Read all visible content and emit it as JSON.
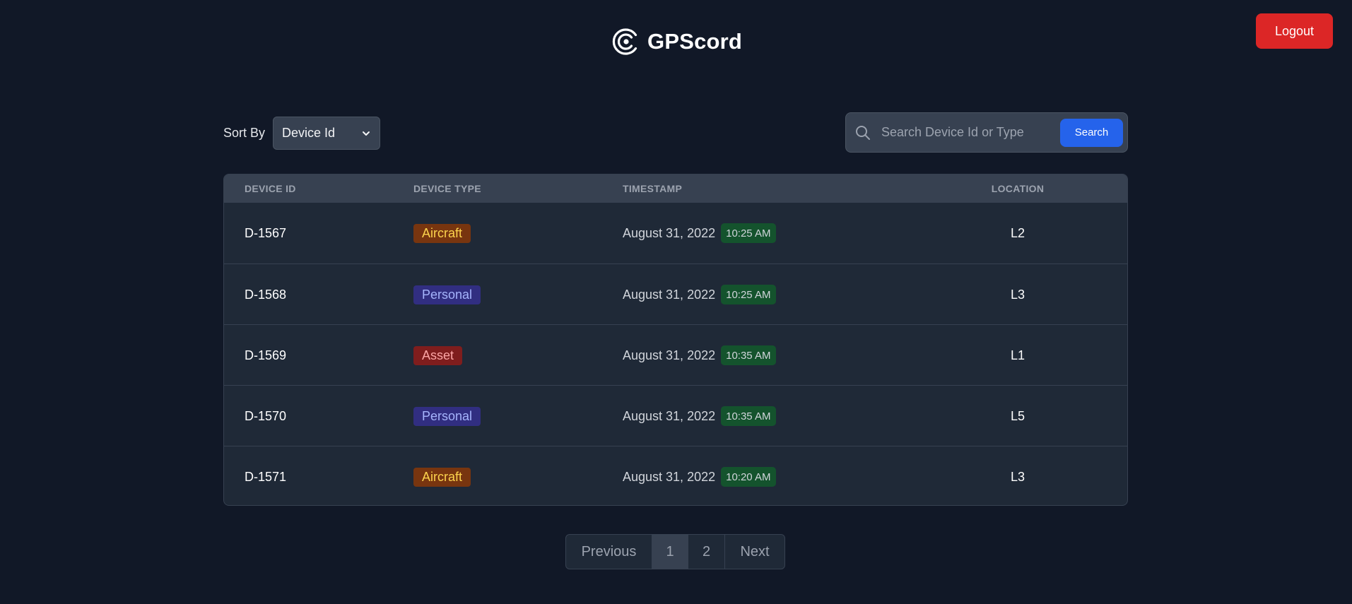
{
  "header": {
    "app_name": "GPScord",
    "logout_label": "Logout"
  },
  "controls": {
    "sort_label": "Sort By",
    "sort_selected": "Device Id",
    "search_placeholder": "Search Device Id or Type",
    "search_button": "Search"
  },
  "table": {
    "columns": [
      "DEVICE ID",
      "DEVICE TYPE",
      "TIMESTAMP",
      "LOCATION"
    ],
    "rows": [
      {
        "device_id": "D-1567",
        "type": "Aircraft",
        "date": "August 31, 2022",
        "time": "10:25 AM",
        "location": "L2"
      },
      {
        "device_id": "D-1568",
        "type": "Personal",
        "date": "August 31, 2022",
        "time": "10:25 AM",
        "location": "L3"
      },
      {
        "device_id": "D-1569",
        "type": "Asset",
        "date": "August 31, 2022",
        "time": "10:35 AM",
        "location": "L1"
      },
      {
        "device_id": "D-1570",
        "type": "Personal",
        "date": "August 31, 2022",
        "time": "10:35 AM",
        "location": "L5"
      },
      {
        "device_id": "D-1571",
        "type": "Aircraft",
        "date": "August 31, 2022",
        "time": "10:20 AM",
        "location": "L3"
      }
    ]
  },
  "pagination": {
    "previous": "Previous",
    "pages": [
      "1",
      "2"
    ],
    "current_page": "1",
    "next": "Next"
  },
  "colors": {
    "background": "#111827",
    "logout": "#dc2626",
    "search_button": "#2563eb",
    "aircraft_badge": "#78350f",
    "personal_badge": "#312e81",
    "asset_badge": "#7f1d1d",
    "time_badge": "#14532d"
  },
  "icons": {
    "logo": "gpscord-logo-icon",
    "search": "search-icon",
    "sort_caret": "chevron-down-icon"
  }
}
